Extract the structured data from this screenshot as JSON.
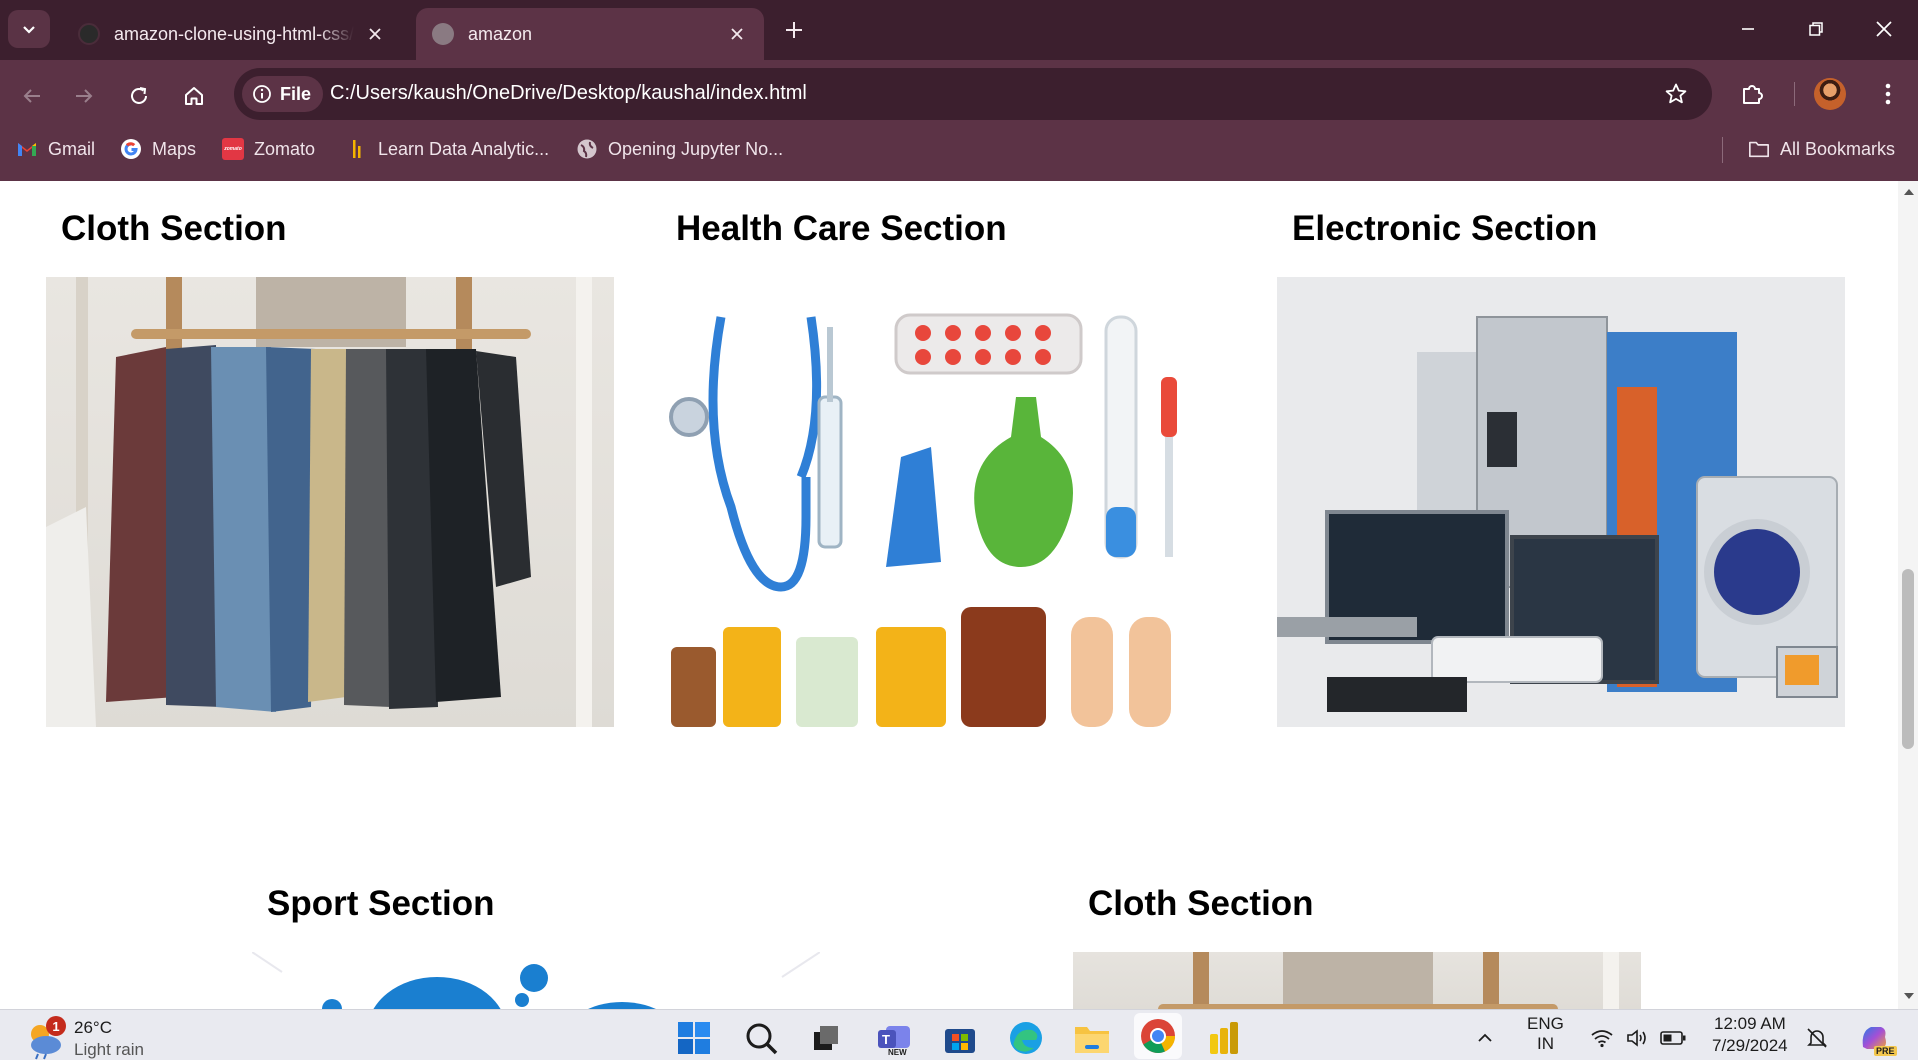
{
  "browser": {
    "tabs": [
      {
        "title": "amazon-clone-using-html-css/s",
        "active": false
      },
      {
        "title": "amazon",
        "active": true
      }
    ],
    "site_chip": "File",
    "url": "C:/Users/kaush/OneDrive/Desktop/kaushal/index.html",
    "bookmarks": [
      {
        "label": "Gmail",
        "icon": "gmail-icon"
      },
      {
        "label": "Maps",
        "icon": "google-icon"
      },
      {
        "label": "Zomato",
        "icon": "zomato-icon"
      },
      {
        "label": "Learn Data Analytic...",
        "icon": "analytics-icon"
      },
      {
        "label": "Opening Jupyter No...",
        "icon": "globe-icon"
      }
    ],
    "all_bookmarks": "All Bookmarks",
    "zomato_logo_text": "zomato"
  },
  "page": {
    "sections": [
      {
        "title": "Cloth Section",
        "image": "clothes-rack"
      },
      {
        "title": "Health Care Section",
        "image": "medical-supplies"
      },
      {
        "title": "Electronic Section",
        "image": "home-appliances"
      },
      {
        "title": "Sport Section",
        "image": "sports-equipment"
      },
      {
        "title": "Cloth Section",
        "image": "clothes-rack"
      }
    ]
  },
  "taskbar": {
    "weather": {
      "temp": "26°C",
      "condition": "Light rain",
      "badge": "1"
    },
    "apps": [
      "start",
      "search",
      "task-view",
      "teams",
      "store",
      "edge",
      "file-explorer",
      "chrome",
      "power-bi"
    ],
    "teams_badge": "NEW",
    "lang_line1": "ENG",
    "lang_line2": "IN",
    "time": "12:09 AM",
    "date": "7/29/2024",
    "copilot_badge": "PRE"
  },
  "colors": {
    "frame_dark": "#3c1f2e",
    "frame_mid": "#5c3346",
    "taskbar": "#e9eaf0"
  }
}
